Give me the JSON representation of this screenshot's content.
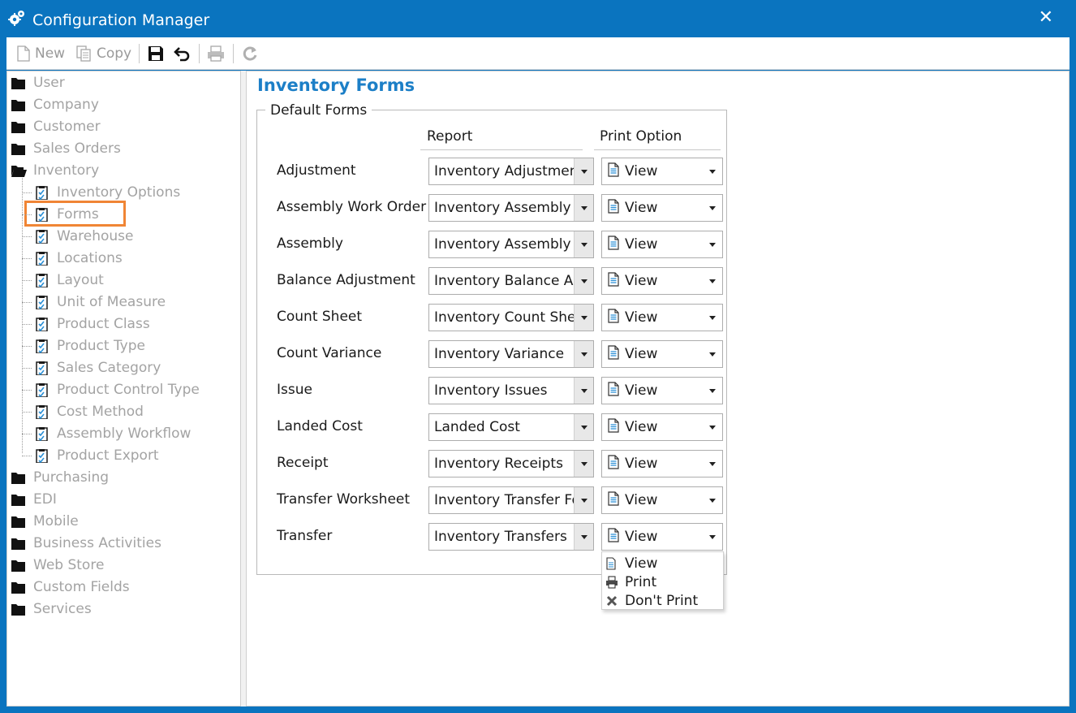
{
  "window": {
    "title": "Configuration Manager",
    "close_glyph": "✕",
    "accent_color": "#0a74bf"
  },
  "toolbar": {
    "new_label": "New",
    "copy_label": "Copy",
    "icons": [
      "new-document-icon",
      "copy-icon",
      "save-icon",
      "undo-icon",
      "print-icon",
      "refresh-icon"
    ]
  },
  "tree": {
    "top_folders": [
      "User",
      "Company",
      "Customer",
      "Sales Orders"
    ],
    "inventory_folder": "Inventory",
    "inventory_children": [
      "Inventory Options",
      "Forms",
      "Warehouse",
      "Locations",
      "Layout",
      "Unit of Measure",
      "Product Class",
      "Product Type",
      "Sales Category",
      "Product Control Type",
      "Cost Method",
      "Assembly Workflow",
      "Product Export"
    ],
    "bottom_folders": [
      "Purchasing",
      "EDI",
      "Mobile",
      "Business Activities",
      "Web Store",
      "Custom Fields",
      "Services"
    ],
    "selected": "Forms",
    "highlight_color": "#f08535"
  },
  "main": {
    "title": "Inventory Forms",
    "title_color": "#1c7fc7",
    "group_label": "Default Forms",
    "col_report": "Report",
    "col_print_option": "Print Option",
    "rows": [
      {
        "label": "Adjustment",
        "report": "Inventory Adjustment",
        "print_option": "View"
      },
      {
        "label": "Assembly Work Order",
        "report": "Inventory Assembly Work Order",
        "print_option": "View"
      },
      {
        "label": "Assembly",
        "report": "Inventory Assembly",
        "print_option": "View"
      },
      {
        "label": "Balance Adjustment",
        "report": "Inventory Balance Adjustment",
        "print_option": "View"
      },
      {
        "label": "Count Sheet",
        "report": "Inventory Count Sheet",
        "print_option": "View"
      },
      {
        "label": "Count Variance",
        "report": "Inventory Variance",
        "print_option": "View"
      },
      {
        "label": "Issue",
        "report": "Inventory Issues",
        "print_option": "View"
      },
      {
        "label": "Landed Cost",
        "report": "Landed Cost",
        "print_option": "View"
      },
      {
        "label": "Receipt",
        "report": "Inventory Receipts",
        "print_option": "View"
      },
      {
        "label": "Transfer Worksheet",
        "report": "Inventory Transfer Form",
        "print_option": "View"
      },
      {
        "label": "Transfer",
        "report": "Inventory Transfers",
        "print_option": "View"
      }
    ]
  },
  "dropdown": {
    "items": [
      {
        "label": "View",
        "icon": "document-icon"
      },
      {
        "label": "Print",
        "icon": "printer-icon"
      },
      {
        "label": "Don't Print",
        "icon": "x-icon"
      }
    ]
  }
}
